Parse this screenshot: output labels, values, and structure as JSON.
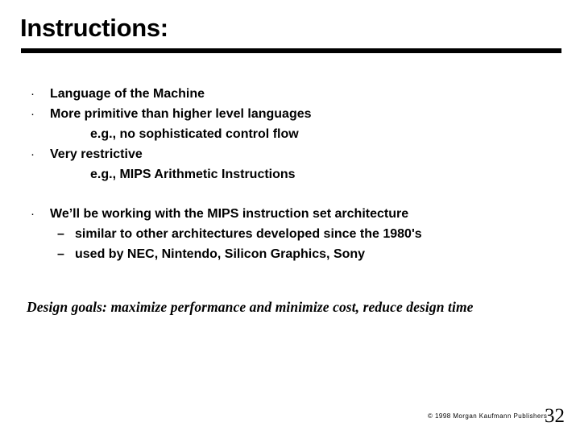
{
  "slide": {
    "title": "Instructions:",
    "bullet_glyph": "·",
    "dash_glyph": "–",
    "lines": [
      {
        "kind": "bullet1",
        "text": "Language of the Machine"
      },
      {
        "kind": "bullet1",
        "text": "More primitive than higher level languages"
      },
      {
        "kind": "sub1",
        "text": "e.g., no sophisticated control flow"
      },
      {
        "kind": "bullet1",
        "text": "Very restrictive"
      },
      {
        "kind": "sub1",
        "text": "e.g., MIPS Arithmetic Instructions"
      },
      {
        "kind": "spacer",
        "text": ""
      },
      {
        "kind": "bullet1",
        "text": "We’ll be working with the MIPS instruction set architecture"
      },
      {
        "kind": "bullet2",
        "text": "similar to other architectures developed since the 1980's"
      },
      {
        "kind": "bullet2",
        "text": "used by NEC, Nintendo, Silicon Graphics, Sony"
      }
    ],
    "design_goals": "Design goals:  maximize performance and minimize cost,  reduce design time",
    "copyright": "© 1998 Morgan Kaufmann Publishers",
    "page_number": "32",
    "colors": {
      "background": "#ffffff",
      "text": "#000000",
      "rule": "#000000"
    }
  }
}
